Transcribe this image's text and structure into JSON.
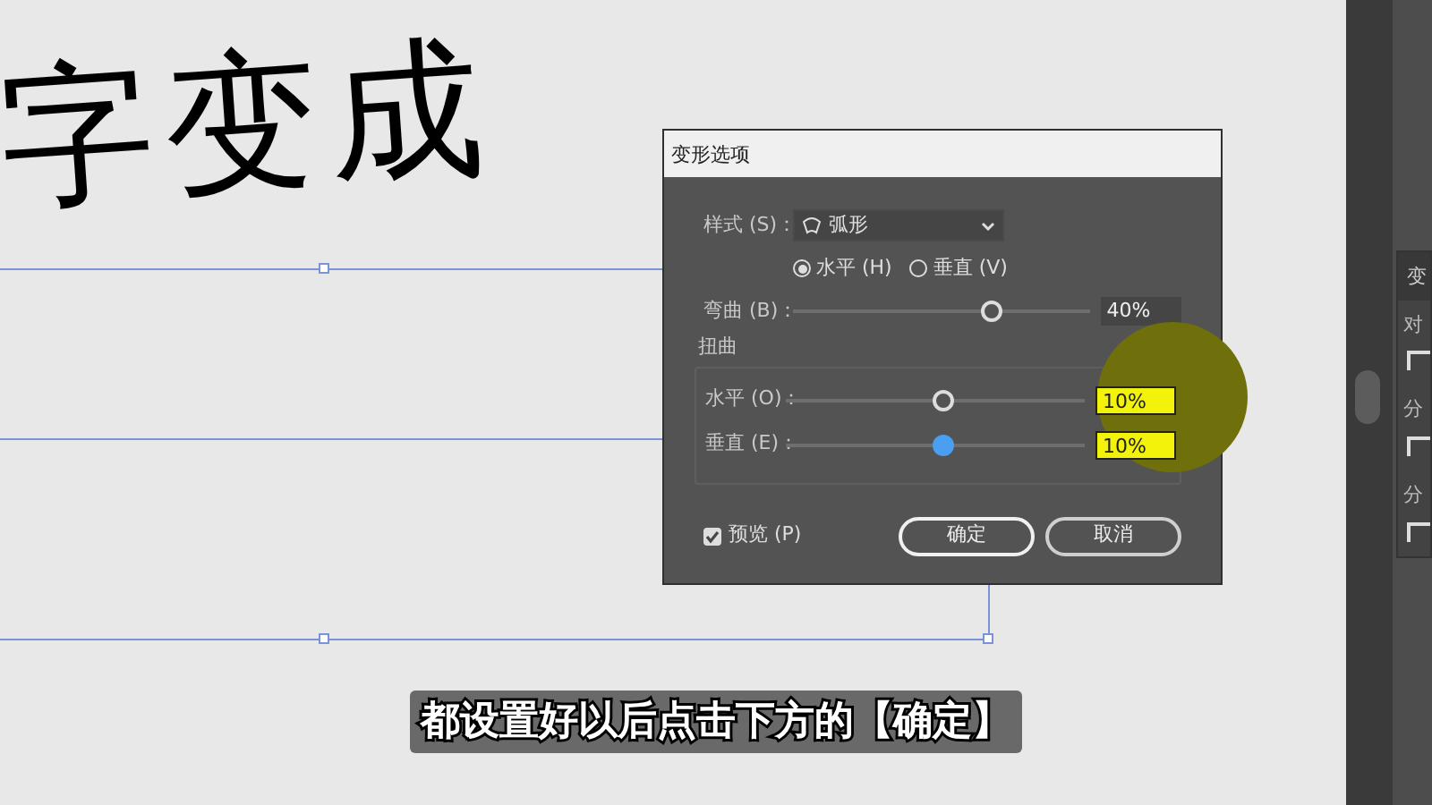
{
  "canvas": {
    "art_text": "字变成"
  },
  "dialog": {
    "title": "变形选项",
    "style": {
      "label": "样式 (S)：",
      "value": "弧形"
    },
    "orientation": [
      {
        "label": "水平 (H)",
        "selected": true
      },
      {
        "label": "垂直 (V)",
        "selected": false
      }
    ],
    "bend": {
      "label": "弯曲 (B)：",
      "level": 0.68,
      "value": "40%"
    },
    "distortion": {
      "title": "扭曲",
      "sliders": [
        {
          "label": "水平 (O)：",
          "level": 0.53,
          "value": "10%",
          "active": false
        },
        {
          "label": "垂直 (E)：",
          "level": 0.53,
          "value": "10%",
          "active": true
        }
      ]
    },
    "preview": {
      "label": "预览 (P)",
      "checked": true
    },
    "buttons": [
      {
        "label": "确定",
        "kind": "primary"
      },
      {
        "label": "取消",
        "kind": "secondary"
      }
    ]
  },
  "side_panel": {
    "title": "变",
    "sections": [
      "对",
      "分",
      "分"
    ]
  },
  "subtitle": "都设置好以后点击下方的【确定】"
}
